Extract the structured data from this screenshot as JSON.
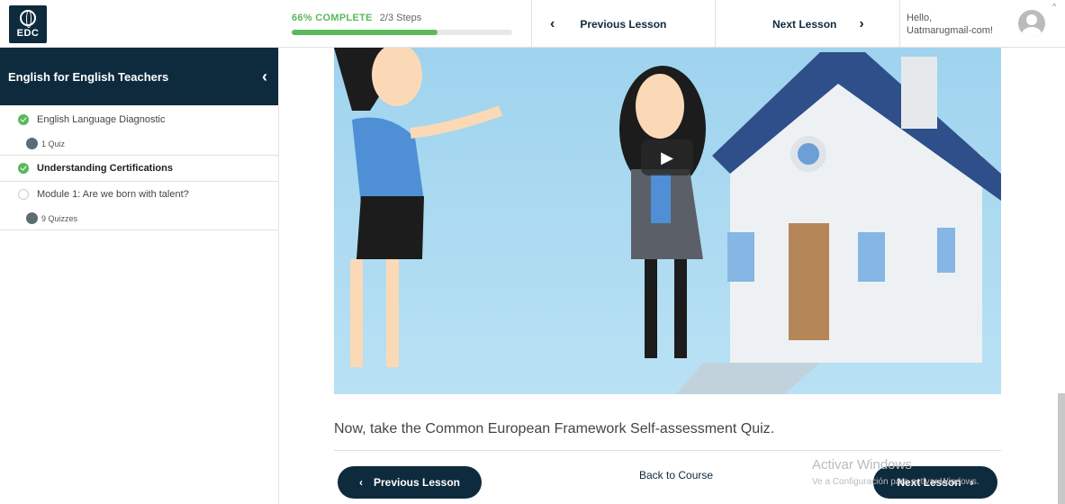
{
  "brand": {
    "logo_text": "EDC"
  },
  "progress": {
    "percent_label": "66% COMPLETE",
    "steps_label": "2/3 Steps",
    "fraction": 0.66
  },
  "topnav": {
    "previous_label": "Previous Lesson",
    "next_label": "Next Lesson"
  },
  "user": {
    "greeting": "Hello,",
    "name": "Uatmarugmail-com!"
  },
  "sidebar": {
    "course_title": "English for English Teachers",
    "items": [
      {
        "label": "English Language Diagnostic",
        "status": "complete",
        "sub": "1 Quiz"
      },
      {
        "label": "Understanding Certifications",
        "status": "complete",
        "sub": ""
      },
      {
        "label": "Module 1: Are we born with talent?",
        "status": "incomplete",
        "sub": "9 Quizzes"
      }
    ]
  },
  "content": {
    "caption": "Now, take the Common European Framework Self-assessment Quiz."
  },
  "footer": {
    "previous_label": "Previous Lesson",
    "back_label": "Back to Course",
    "next_label": "Next Lesson"
  },
  "watermark": {
    "line1": "Activar Windows",
    "line2": "Ve a Configuración para activar Windows."
  },
  "colors": {
    "navy": "#0e2a3d",
    "green": "#5cb85c"
  }
}
